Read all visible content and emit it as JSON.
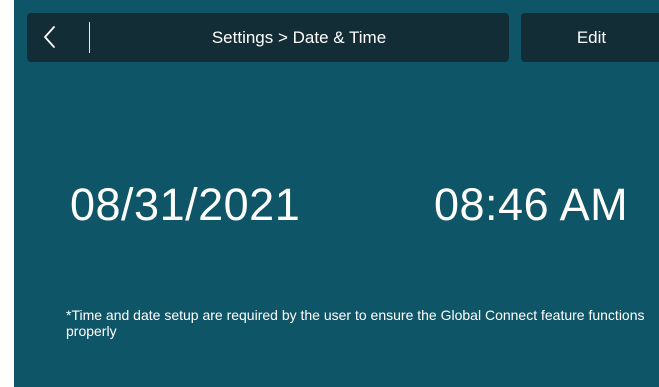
{
  "header": {
    "title": "Settings > Date & Time",
    "back_icon": "chevron-left-icon"
  },
  "toolbar": {
    "edit_label": "Edit"
  },
  "main": {
    "date": "08/31/2021",
    "time": "08:46 AM",
    "footnote": "*Time and date setup are required by the user to ensure the Global Connect feature functions properly"
  },
  "colors": {
    "background": "#0f5568",
    "header_background": "#132d36",
    "text": "#ffffff"
  }
}
